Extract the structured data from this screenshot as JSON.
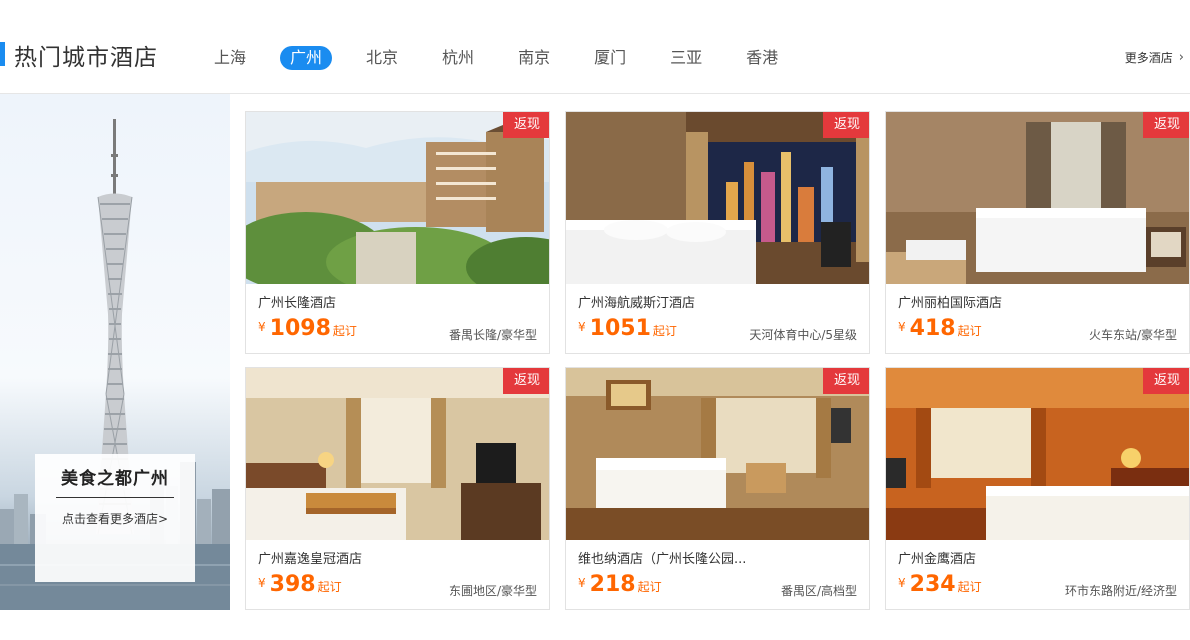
{
  "header": {
    "title": "热门城市酒店",
    "tabs": [
      "上海",
      "广州",
      "北京",
      "杭州",
      "南京",
      "厦门",
      "三亚",
      "香港"
    ],
    "active_tab_index": 1,
    "more_label": "更多酒店",
    "more_icon": "chevron-right-icon"
  },
  "promo": {
    "title": "美食之都广州",
    "link": "点击查看更多酒店>"
  },
  "colors": {
    "accent": "#1a8cf0",
    "badge": "#e4393c",
    "price": "#ff6600"
  },
  "hotels": [
    {
      "name": "广州长隆酒店",
      "currency": "¥",
      "price": "1098",
      "from_label": "起订",
      "location": "番禺长隆/豪华型",
      "badge": "返现"
    },
    {
      "name": "广州海航威斯汀酒店",
      "currency": "¥",
      "price": "1051",
      "from_label": "起订",
      "location": "天河体育中心/5星级",
      "badge": "返现"
    },
    {
      "name": "广州丽柏国际酒店",
      "currency": "¥",
      "price": "418",
      "from_label": "起订",
      "location": "火车东站/豪华型",
      "badge": "返现"
    },
    {
      "name": "广州嘉逸皇冠酒店",
      "currency": "¥",
      "price": "398",
      "from_label": "起订",
      "location": "东圃地区/豪华型",
      "badge": "返现"
    },
    {
      "name": "维也纳酒店（广州长隆公园...",
      "currency": "¥",
      "price": "218",
      "from_label": "起订",
      "location": "番禺区/高档型",
      "badge": "返现"
    },
    {
      "name": "广州金鹰酒店",
      "currency": "¥",
      "price": "234",
      "from_label": "起订",
      "location": "环市东路附近/经济型",
      "badge": "返现"
    }
  ]
}
